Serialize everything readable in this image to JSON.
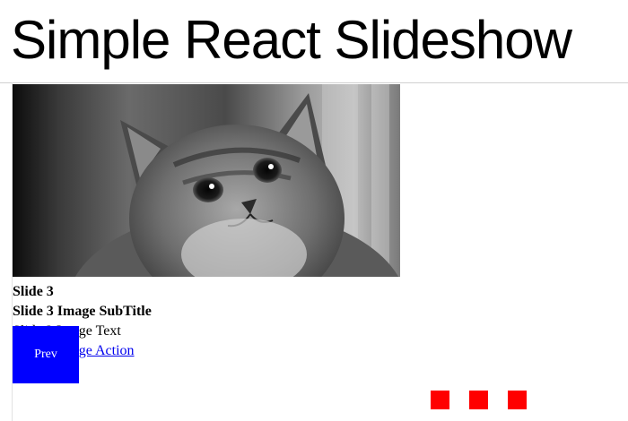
{
  "header": {
    "title": "Simple React Slideshow"
  },
  "slide": {
    "image_subject": "grayscale kitten photo",
    "title": "Slide 3",
    "subtitle": "Slide 3 Image SubTitle",
    "text": "Slide 3 Image Text",
    "action_label": "Slide 3 Image Action"
  },
  "controls": {
    "prev_label": "Prev",
    "dot_count": 3,
    "dot_color": "#ff0000",
    "prev_color": "#0000ff"
  }
}
